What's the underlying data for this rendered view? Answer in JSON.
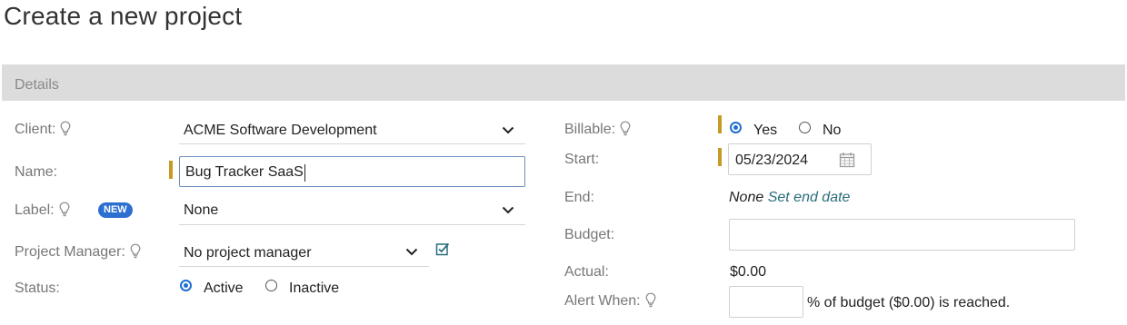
{
  "page": {
    "title": "Create a new project"
  },
  "section": {
    "title": "Details"
  },
  "left": {
    "client": {
      "label": "Client:",
      "value": "ACME Software Development",
      "icon": "lightbulb-icon"
    },
    "name": {
      "label": "Name:",
      "value": "Bug Tracker SaaS"
    },
    "label_field": {
      "label": "Label:",
      "badge": "NEW",
      "value": "None"
    },
    "project_manager": {
      "label": "Project Manager:",
      "value": "No project manager",
      "icon": "edit-checkbox-icon"
    },
    "status": {
      "label": "Status:",
      "options": [
        "Active",
        "Inactive"
      ],
      "selected": "Active"
    }
  },
  "right": {
    "billable": {
      "label": "Billable:",
      "options": [
        "Yes",
        "No"
      ],
      "selected": "Yes"
    },
    "start": {
      "label": "Start:",
      "value": "05/23/2024",
      "icon": "calendar-icon"
    },
    "end": {
      "label": "End:",
      "none_text": "None",
      "link": "Set end date"
    },
    "budget": {
      "label": "Budget:",
      "value": ""
    },
    "actual": {
      "label": "Actual:",
      "value": "$0.00"
    },
    "alert_when": {
      "label": "Alert When:",
      "value": "",
      "suffix": "% of budget ($0.00) is reached."
    }
  },
  "colors": {
    "required_marker": "#c69a24",
    "radio_checked": "#1f6fd1",
    "badge": "#2d6fd0",
    "link": "#2a6d7c",
    "section_bar": "#dcdcdc"
  }
}
